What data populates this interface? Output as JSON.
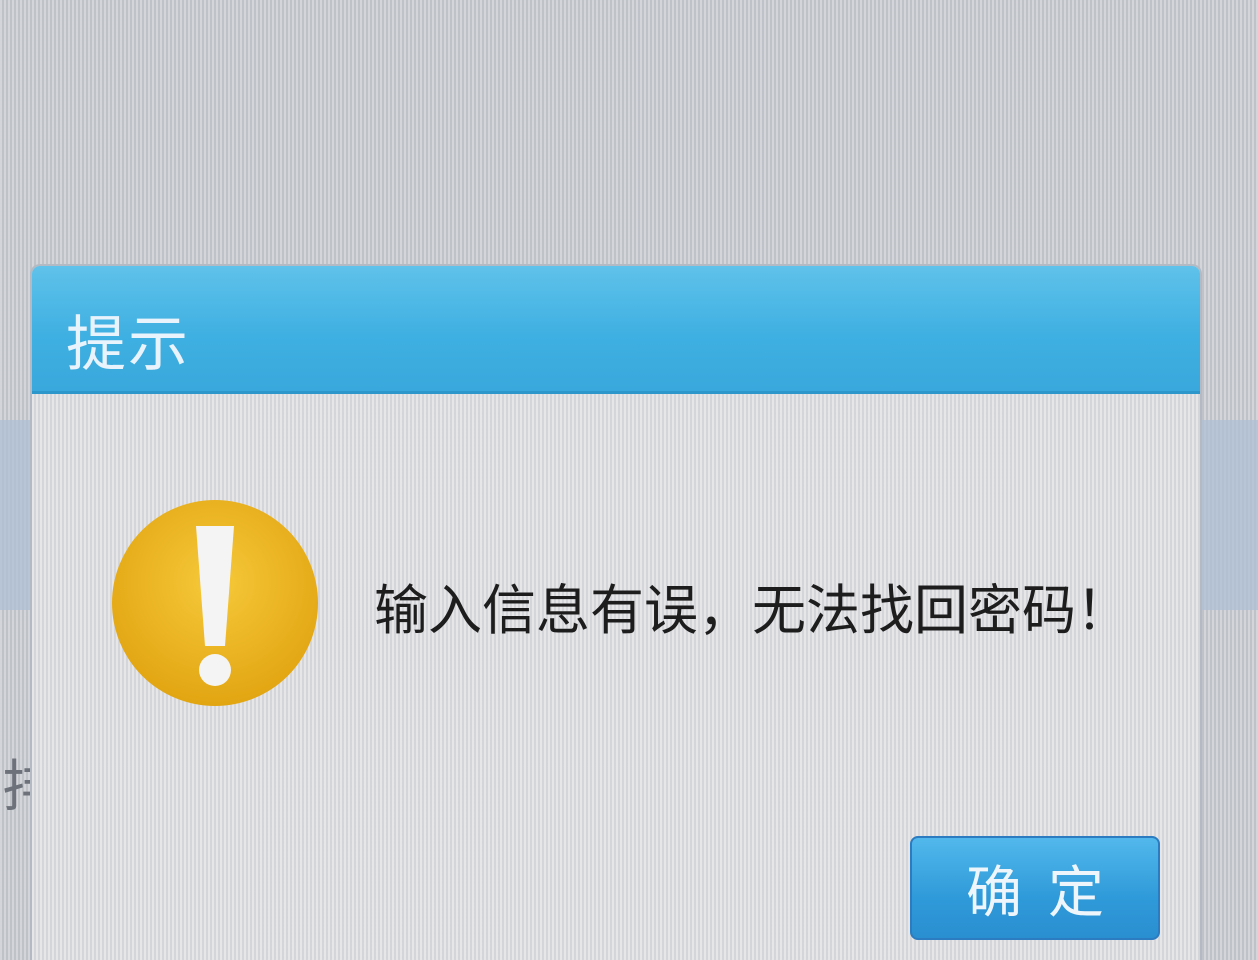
{
  "dialog": {
    "title": "提示",
    "message": "输入信息有误，无法找回密码！",
    "icon": "warning-exclamation-icon",
    "ok_label": "确定"
  },
  "background": {
    "partial_glyph": "排"
  },
  "colors": {
    "titlebar": "#3fb0e2",
    "button": "#2f9ad9",
    "warning_icon": "#efb91a"
  }
}
